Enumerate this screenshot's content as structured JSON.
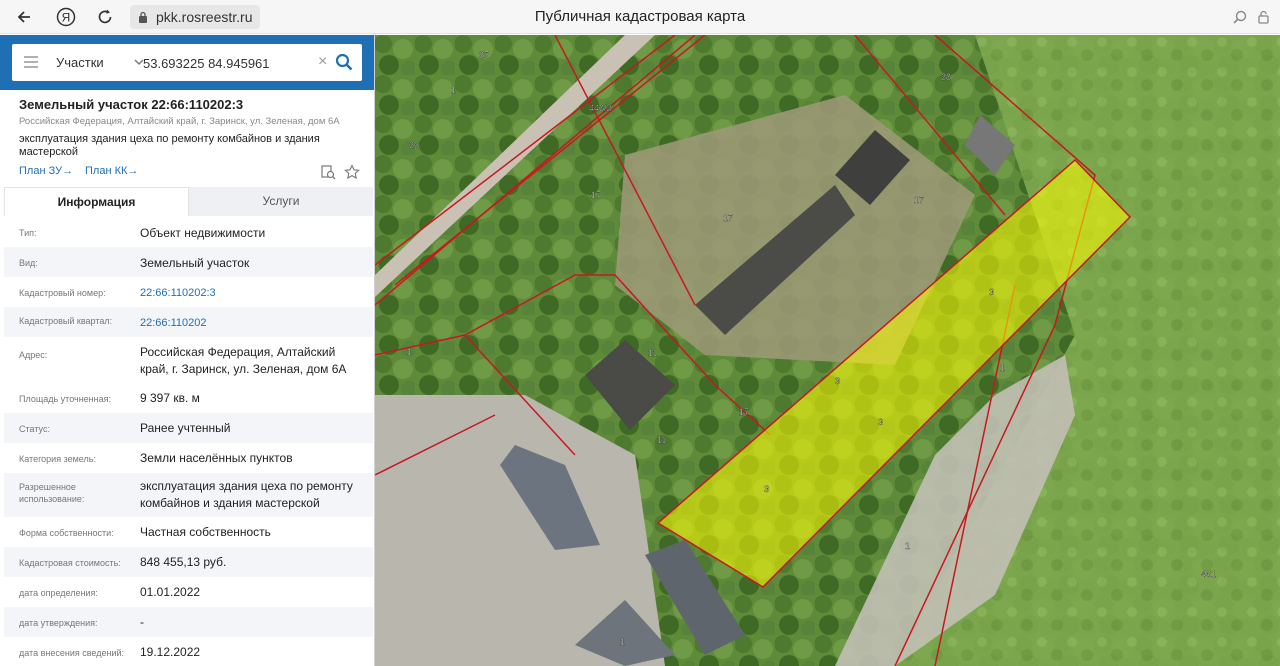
{
  "browser": {
    "url": "pkk.rosreestr.ru",
    "page_title": "Публичная кадастровая карта",
    "yandex_glyph": "Я"
  },
  "search": {
    "type_label": "Участки",
    "query": "53.693225 84.945961"
  },
  "object": {
    "title": "Земельный участок 22:66:110202:3",
    "address": "Российская Федерация, Алтайский край, г. Заринск, ул. Зеленая, дом 6А",
    "permitted_use": "эксплуатация здания цеха по ремонту комбайнов и здания мастерской",
    "plan_zu": "План ЗУ→",
    "plan_kk": "План КК→"
  },
  "tabs": [
    "Информация",
    "Услуги"
  ],
  "info": [
    {
      "key": "Тип:",
      "value": "Объект недвижимости"
    },
    {
      "key": "Вид:",
      "value": "Земельный участок"
    },
    {
      "key": "Кадастровый номер:",
      "value": "22:66:110202:3"
    },
    {
      "key": "Кадастровый квартал:",
      "value": "22:66:110202"
    },
    {
      "key": "Адрес:",
      "value": "Российская Федерация, Алтайский край, г. Заринск, ул. Зеленая, дом 6А"
    },
    {
      "key": "Площадь уточненная:",
      "value": "9 397 кв. м"
    },
    {
      "key": "Статус:",
      "value": "Ранее учтенный"
    },
    {
      "key": "Категория земель:",
      "value": "Земли населённых пунктов"
    },
    {
      "key": "Разрешенное использование:",
      "value": "эксплуатация здания цеха по ремонту комбайнов и здания мастерской"
    },
    {
      "key": "Форма собственности:",
      "value": "Частная собственность"
    },
    {
      "key": "Кадастровая стоимость:",
      "value": "848 455,13 руб."
    },
    {
      "key": "дата определения:",
      "value": "01.01.2022"
    },
    {
      "key": "дата утверждения:",
      "value": "-"
    },
    {
      "key": "дата внесения сведений:",
      "value": "19.12.2022"
    }
  ],
  "map_labels": {
    "l25": "25",
    "l1a": "1",
    "l26": "26",
    "l443": "443/2",
    "l28": "28",
    "l17a": "17",
    "l17b": "17",
    "l17c": "17",
    "l17d": "17",
    "l11a": "11",
    "l11b": "11",
    "l3a": "3",
    "l3b": "3",
    "l3c": "3",
    "l3d": "3",
    "l1b": "1",
    "l1c": "1",
    "l1d": "1",
    "l1e": "1",
    "l461": "461"
  },
  "colors": {
    "accent": "#1e6fb4",
    "parcel_fill": "#ffff00",
    "boundary": "#c8181f"
  }
}
